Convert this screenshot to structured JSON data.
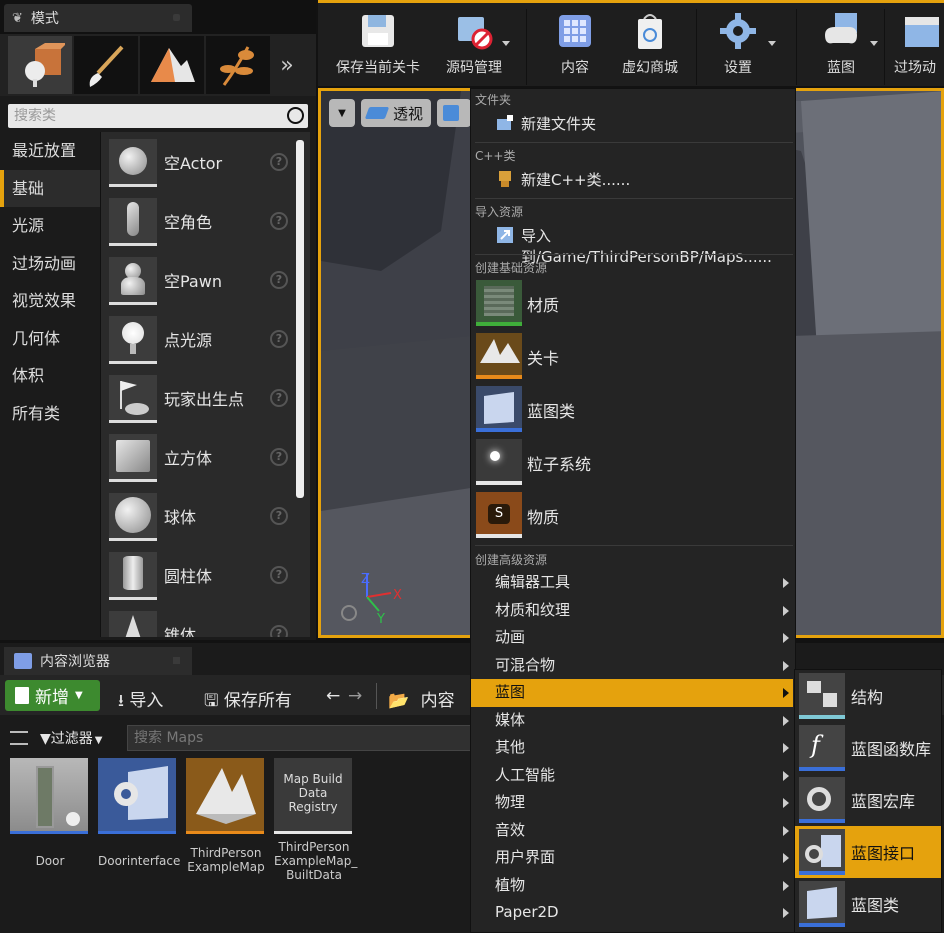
{
  "modes_panel": {
    "title": "模式",
    "search_placeholder": "搜索类",
    "categories": [
      "最近放置",
      "基础",
      "光源",
      "过场动画",
      "视觉效果",
      "几何体",
      "体积",
      "所有类"
    ],
    "selected_category": "基础",
    "items": [
      "空Actor",
      "空角色",
      "空Pawn",
      "点光源",
      "玩家出生点",
      "立方体",
      "球体",
      "圆柱体",
      "锥体"
    ]
  },
  "toolbar": {
    "buttons": [
      {
        "label": "保存当前关卡"
      },
      {
        "label": "源码管理"
      },
      {
        "label": "内容"
      },
      {
        "label": "虚幻商城"
      },
      {
        "label": "设置"
      },
      {
        "label": "蓝图"
      },
      {
        "label": "过场动"
      }
    ]
  },
  "viewport": {
    "view_mode": "透视",
    "axis": {
      "z": "Z",
      "x": "X",
      "y": "Y"
    }
  },
  "content_browser": {
    "title": "内容浏览器",
    "new_label": "新增",
    "import_label": "导入",
    "save_all_label": "保存所有",
    "path_label": "内容",
    "filter_label": "过滤器",
    "search_placeholder": "搜索 Maps",
    "assets": [
      {
        "name": "Door",
        "bar_color": "#3a6fd8"
      },
      {
        "name": "Doorinterface",
        "bar_color": "#3a6fd8"
      },
      {
        "name": "ThirdPerson ExampleMap",
        "bar_color": "#e88a1a"
      },
      {
        "name": "ThirdPerson ExampleMap_ BuiltData",
        "thumb_text": "Map Build Data Registry",
        "bar_color": "#e6e6e6"
      }
    ]
  },
  "context_menu": {
    "sections": {
      "folder": "文件夹",
      "cpp": "C++类",
      "import": "导入资源",
      "basic": "创建基础资源",
      "advanced": "创建高级资源"
    },
    "new_folder": "新建文件夹",
    "new_cpp": "新建C++类......",
    "import_to": "导入到/Game/ThirdPersonBP/Maps......",
    "basic_assets": [
      {
        "label": "材质",
        "bar_color": "#3fae3a"
      },
      {
        "label": "关卡",
        "bar_color": "#e88a1a"
      },
      {
        "label": "蓝图类",
        "bar_color": "#3a6fd8"
      },
      {
        "label": "粒子系统",
        "bar_color": "#e6e6e6"
      },
      {
        "label": "物质",
        "bar_color": "#e6e6e6"
      }
    ],
    "advanced_items": [
      "编辑器工具",
      "材质和纹理",
      "动画",
      "可混合物",
      "蓝图",
      "媒体",
      "其他",
      "人工智能",
      "物理",
      "音效",
      "用户界面",
      "植物",
      "Paper2D"
    ],
    "highlighted_item": "蓝图"
  },
  "blueprint_submenu": {
    "items": [
      {
        "label": "结构",
        "bar_color": "#7fc9d6"
      },
      {
        "label": "蓝图函数库",
        "bar_color": "#3a6fd8"
      },
      {
        "label": "蓝图宏库",
        "bar_color": "#3a6fd8"
      },
      {
        "label": "蓝图接口",
        "bar_color": "#3a6fd8"
      },
      {
        "label": "蓝图类",
        "bar_color": "#3a6fd8"
      }
    ],
    "highlighted_item": "蓝图接口"
  }
}
